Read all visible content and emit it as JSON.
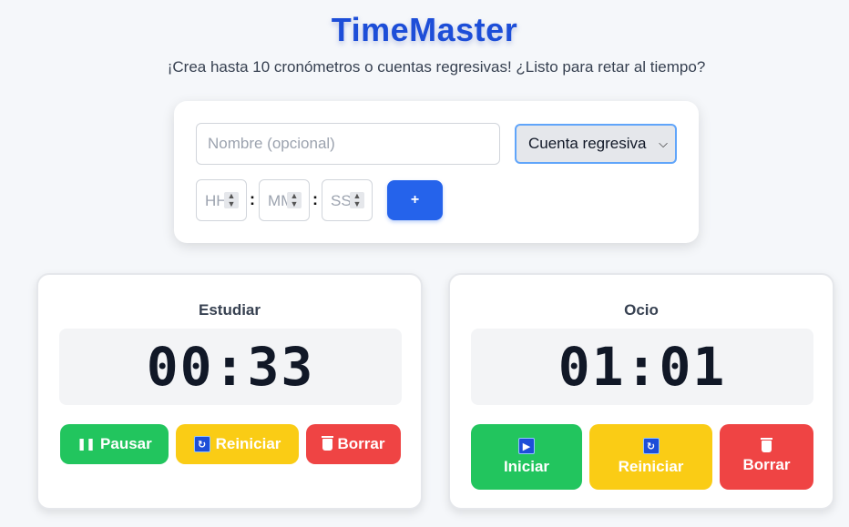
{
  "app": {
    "title": "TimeMaster",
    "subtitle": "¡Crea hasta 10 cronómetros o cuentas regresivas! ¿Listo para retar al tiempo?"
  },
  "form": {
    "name_placeholder": "Nombre (opcional)",
    "mode_selected": "Cuenta regresiva",
    "hours_placeholder": "HH",
    "minutes_placeholder": "MM",
    "seconds_placeholder": "SS",
    "colon": ":",
    "add_label": "+"
  },
  "timers": [
    {
      "name": "Estudiar",
      "time": "00:33",
      "primary_label": "Pausar",
      "primary_icon": "pause-icon",
      "reset_label": "Reiniciar",
      "delete_label": "Borrar"
    },
    {
      "name": "Ocio",
      "time": "01:01",
      "primary_label": "Iniciar",
      "primary_icon": "play-icon",
      "reset_label": "Reiniciar",
      "delete_label": "Borrar"
    }
  ],
  "colors": {
    "primary": "#2563eb",
    "start": "#22c55e",
    "reset": "#facc15",
    "delete": "#ef4444"
  }
}
